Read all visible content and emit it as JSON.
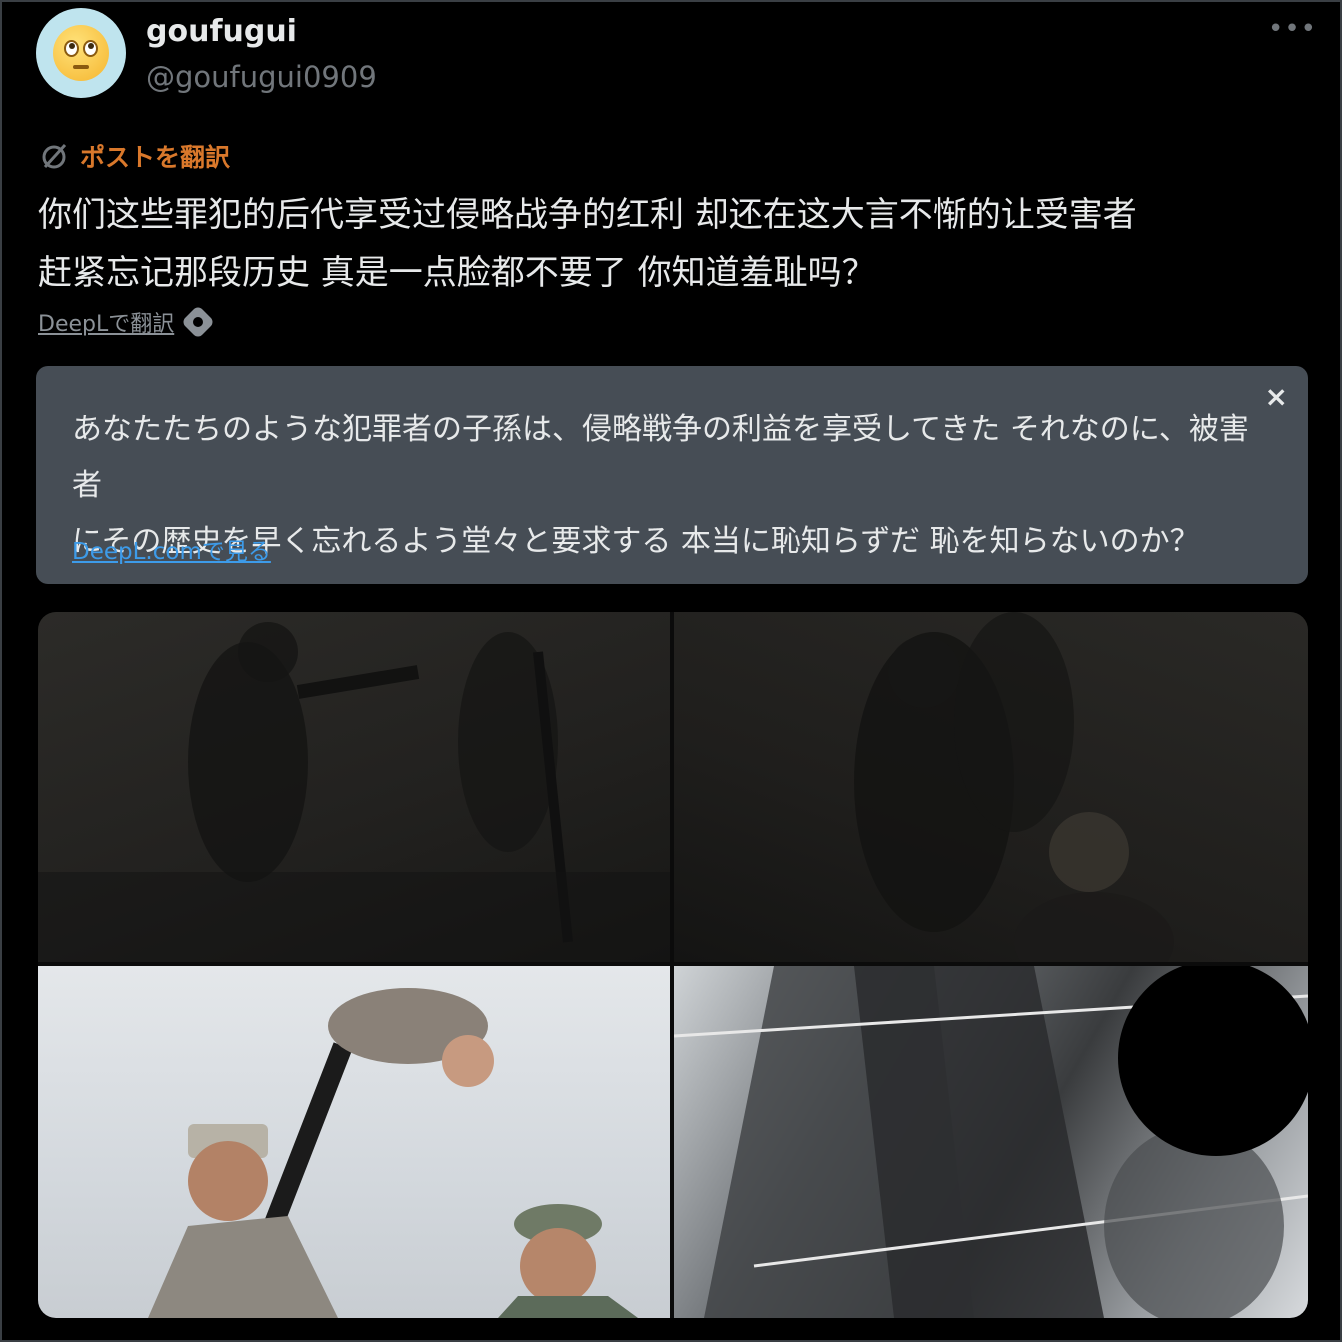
{
  "header": {
    "display_name": "goufugui",
    "handle": "@goufugui0909",
    "avatar_icon": "face-with-rolling-eyes-icon",
    "more_label": "•••"
  },
  "translate": {
    "label": "ポストを翻訳",
    "icon": "translate-icon",
    "accent_color": "#d9782b"
  },
  "post": {
    "text": "你们这些罪犯的后代享受过侵略战争的红利  却还在这大言不惭的让受害者\n赶紧忘记那段历史  真是一点脸都不要了  你知道羞耻吗？"
  },
  "deepl": {
    "label": "DeepLで翻訳"
  },
  "translation_card": {
    "close_label": "×",
    "text": "あなたたちのような犯罪者の子孫は、侵略戦争の利益を享受してきた  それなのに、被害者\nにその歴史を早く忘れるよう堂々と要求する  本当に恥知らずだ  恥を知らないのか？",
    "link_label": "DeepL.comで見る",
    "link_color": "#3d9be9"
  }
}
